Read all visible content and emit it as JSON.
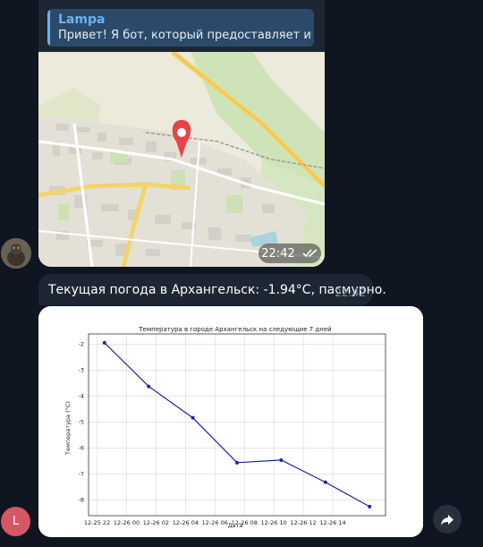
{
  "reply": {
    "name": "Lampa",
    "text": "Привет! Я бот, который предоставляет инф..."
  },
  "map_message": {
    "time": "22:42",
    "status_icon": "double-check-icon",
    "pin_icon": "location-pin-icon"
  },
  "weather_message": {
    "text": "Текущая погода в Архангельск: -1.94°C, пасмурно.",
    "time": "22:42"
  },
  "chart_data": {
    "type": "line",
    "title": "Температура в городе Архангельск на следующие 7 дней",
    "xlabel": "Дата",
    "ylabel": "Температура (°C)",
    "x_ticks": [
      "12-25 22",
      "12-26 00",
      "12-26 02",
      "12-26 04",
      "12-26 06",
      "12-26 08",
      "12-26 10",
      "12-26 12",
      "12-26 14"
    ],
    "y_ticks": [
      "-2",
      "-3",
      "-4",
      "-5",
      "-6",
      "-7",
      "-8"
    ],
    "points": [
      {
        "x": "2023-12-25T22:30",
        "y": -1.94
      },
      {
        "x": "2023-12-26T01:30",
        "y": -3.62
      },
      {
        "x": "2023-12-26T04:30",
        "y": -4.83
      },
      {
        "x": "2023-12-26T07:30",
        "y": -6.56
      },
      {
        "x": "2023-12-26T10:30",
        "y": -6.46
      },
      {
        "x": "2023-12-26T13:30",
        "y": -7.31
      },
      {
        "x": "2023-12-26T16:30",
        "y": -8.25
      }
    ],
    "ylim": [
      -8.6,
      -1.6
    ],
    "grid": true,
    "line_color": "#1f1fa8"
  },
  "avatar_user": {
    "initial": "L",
    "color": "#d45763"
  },
  "forward_icon": "forward-arrow-icon"
}
